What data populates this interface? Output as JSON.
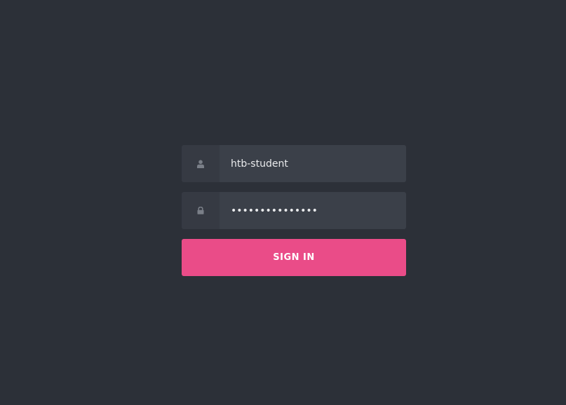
{
  "login": {
    "username": {
      "icon": "user-icon",
      "value": "htb-student"
    },
    "password": {
      "icon": "lock-icon",
      "value": "htb-student-pwd"
    },
    "submit_label": "SIGN IN"
  },
  "colors": {
    "background": "#2c3038",
    "icon_cell": "#363a43",
    "input_background": "#3b4049",
    "input_text": "#e9eaec",
    "icon": "#7a7f88",
    "accent": "#ea4c88"
  }
}
